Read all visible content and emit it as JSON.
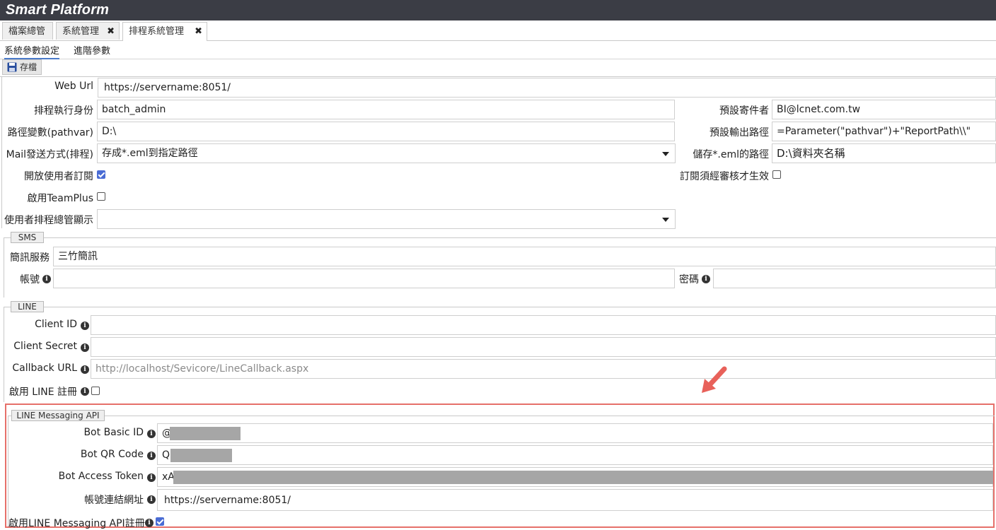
{
  "app": {
    "title": "Smart Platform"
  },
  "tabs": [
    {
      "label": "檔案總管",
      "closable": false
    },
    {
      "label": "系統管理",
      "closable": true
    },
    {
      "label": "排程系統管理",
      "closable": true,
      "active": true
    }
  ],
  "close_glyph": "✖",
  "subtabs": [
    {
      "label": "系統參數設定",
      "active": true
    },
    {
      "label": "進階參數"
    }
  ],
  "toolbar": {
    "save_label": "存檔",
    "save_icon": "floppy-disk-icon"
  },
  "info_glyph": "i",
  "general": {
    "web_url": {
      "label": "Web Url",
      "value": "https://servername:8051/"
    },
    "exec_identity": {
      "label": "排程執行身份",
      "value": "batch_admin"
    },
    "default_sender": {
      "label": "預設寄件者",
      "value": "BI@lcnet.com.tw"
    },
    "pathvar": {
      "label": "路徑變數(pathvar)",
      "value": "D:\\"
    },
    "default_output_path": {
      "label": "預設輸出路徑",
      "value": "=Parameter(\"pathvar\")+\"ReportPath\\\\\""
    },
    "mail_method": {
      "label": "Mail發送方式(排程)",
      "value": "存成*.eml到指定路徑"
    },
    "eml_path": {
      "label": "儲存*.eml的路徑",
      "value": "D:\\資料夾名稱"
    },
    "open_subscription": {
      "label": "開放使用者訂閱",
      "checked": true
    },
    "subscription_review": {
      "label": "訂閱須經審核才生效",
      "checked": false
    },
    "enable_teamplus": {
      "label": "啟用TeamPlus",
      "checked": false
    },
    "user_schedule_display": {
      "label": "使用者排程總管顯示",
      "value": ""
    }
  },
  "sms": {
    "legend": "SMS",
    "service": {
      "label": "簡訊服務",
      "value": "三竹簡訊"
    },
    "account": {
      "label": "帳號",
      "value": ""
    },
    "password": {
      "label": "密碼",
      "value": ""
    }
  },
  "line": {
    "legend": "LINE",
    "client_id": {
      "label": "Client ID",
      "value": ""
    },
    "client_secret": {
      "label": "Client Secret",
      "value": ""
    },
    "callback_url": {
      "label": "Callback URL",
      "placeholder": "http://localhost/Sevicore/LineCallback.aspx"
    },
    "enable_line_register": {
      "label": "啟用 LINE 註冊",
      "checked": false
    }
  },
  "line_messaging": {
    "legend": "LINE Messaging API",
    "bot_basic_id": {
      "label": "Bot Basic ID",
      "value": "@"
    },
    "bot_qr_code": {
      "label": "Bot QR Code",
      "value": "QF"
    },
    "bot_access_token": {
      "label": "Bot Access Token",
      "value": "xA"
    },
    "account_link_url": {
      "label": "帳號連結網址",
      "value": "https://servername:8051/"
    },
    "enable_messaging_register": {
      "label": "啟用LINE Messaging API註冊",
      "checked": true
    }
  },
  "colors": {
    "titlebar": "#3b3d45",
    "highlight": "#e6706a",
    "checkbox_on": "#4a6cd4",
    "subtab_active": "#4a7ac9"
  }
}
